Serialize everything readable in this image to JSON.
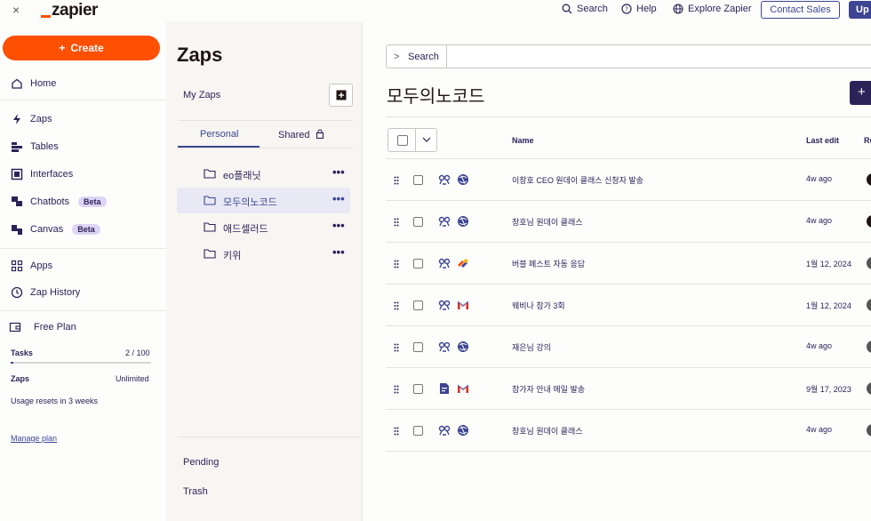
{
  "topbar": {
    "close_glyph": "×",
    "logo": "zapier",
    "search": "Search",
    "help": "Help",
    "explore": "Explore Zapier",
    "contact_sales": "Contact Sales",
    "upgrade": "Up"
  },
  "sidebar": {
    "create_label": "Create",
    "items": [
      {
        "label": "Home",
        "icon": "home-icon"
      },
      {
        "label": "Zaps",
        "icon": "zap-icon"
      },
      {
        "label": "Tables",
        "icon": "tables-icon"
      },
      {
        "label": "Interfaces",
        "icon": "interfaces-icon"
      },
      {
        "label": "Chatbots",
        "icon": "chatbot-icon",
        "badge": "Beta"
      },
      {
        "label": "Canvas",
        "icon": "canvas-icon",
        "badge": "Beta"
      },
      {
        "label": "Apps",
        "icon": "apps-icon"
      },
      {
        "label": "Zap History",
        "icon": "history-icon"
      }
    ],
    "plan": {
      "name": "Free Plan",
      "tasks_label": "Tasks",
      "tasks_value": "2 / 100",
      "tasks_fraction": 0.02,
      "zaps_label": "Zaps",
      "zaps_value": "Unlimited",
      "reset_note": "Usage resets in 3 weeks",
      "manage_link": "Manage plan"
    }
  },
  "folders": {
    "title": "Zaps",
    "my_zaps": "My Zaps",
    "tabs": [
      "Personal",
      "Shared"
    ],
    "active_tab": "Personal",
    "list": [
      {
        "name": "eo플래닛",
        "active": false
      },
      {
        "name": "모두의노코드",
        "active": true
      },
      {
        "name": "애드셀러드",
        "active": false
      },
      {
        "name": "키위",
        "active": false
      }
    ],
    "more_glyph": "•••",
    "pending": "Pending",
    "trash": "Trash"
  },
  "main": {
    "search_label": "Search",
    "folder_title": "모두의노코드",
    "new_zap_glyph": "+",
    "columns": {
      "name": "Name",
      "last_edit": "Last edit",
      "running": "Ru"
    },
    "rows": [
      {
        "name": "이창호 CEO 원데이 클래스 신청자 발송",
        "last_edit": "4w ago",
        "app1": "webhook-icon",
        "app2": "globe-app-icon",
        "run_color": "#201515"
      },
      {
        "name": "창호님 원데이 클래스",
        "last_edit": "4w ago",
        "app1": "webhook-icon",
        "app2": "globe-app-icon",
        "run_color": "#201515"
      },
      {
        "name": "버블 페스트 자동 응답",
        "last_edit": "1월 12, 2024",
        "app1": "webhook-icon",
        "app2": "stack-app-icon",
        "run_color": "#555555"
      },
      {
        "name": "웨비나 참가 3회",
        "last_edit": "1월 12, 2024",
        "app1": "webhook-icon",
        "app2": "gmail-icon",
        "run_color": "#555555"
      },
      {
        "name": "재은님 강의",
        "last_edit": "4w ago",
        "app1": "webhook-icon",
        "app2": "globe-app-icon",
        "run_color": "#555555"
      },
      {
        "name": "참가자 안내 메일 발송",
        "last_edit": "9월 17, 2023",
        "app1": "form-app-icon",
        "app2": "gmail-icon",
        "run_color": "#555555"
      },
      {
        "name": "창호님 원데이 클래스",
        "last_edit": "4w ago",
        "app1": "webhook-icon",
        "app2": "globe-app-icon",
        "run_color": "#555555"
      }
    ]
  },
  "colors": {
    "brand": "#ff4f00",
    "accent": "#3d4592",
    "navy": "#2b2358"
  }
}
